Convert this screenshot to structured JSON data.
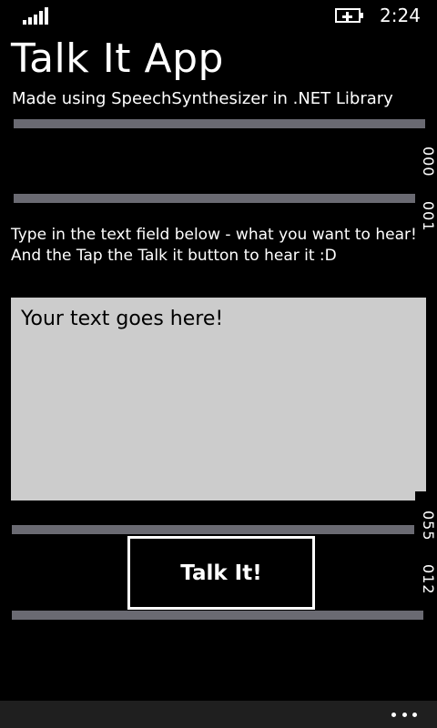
{
  "status_bar": {
    "signal_icon": "signal-strength-icon",
    "battery_icon": "battery-charging-icon",
    "time": "2:24"
  },
  "header": {
    "title": "Talk It App",
    "subtitle": "Made using SpeechSynthesizer in .NET Library"
  },
  "side_counters": [
    "000",
    "001",
    "055",
    "012"
  ],
  "instructions": {
    "line1": "Type in the text field below - what you want to hear!",
    "line2": "And the Tap the Talk it button to hear it :D"
  },
  "text_field": {
    "value": "Your text goes here!"
  },
  "talk_button": {
    "label": "Talk It!"
  },
  "app_bar": {
    "more_icon": "more-ellipsis-icon"
  },
  "colors": {
    "background": "#000000",
    "bar": "#6a6a72",
    "textbox": "#cccccc",
    "app_bar": "#1f1f1f"
  }
}
